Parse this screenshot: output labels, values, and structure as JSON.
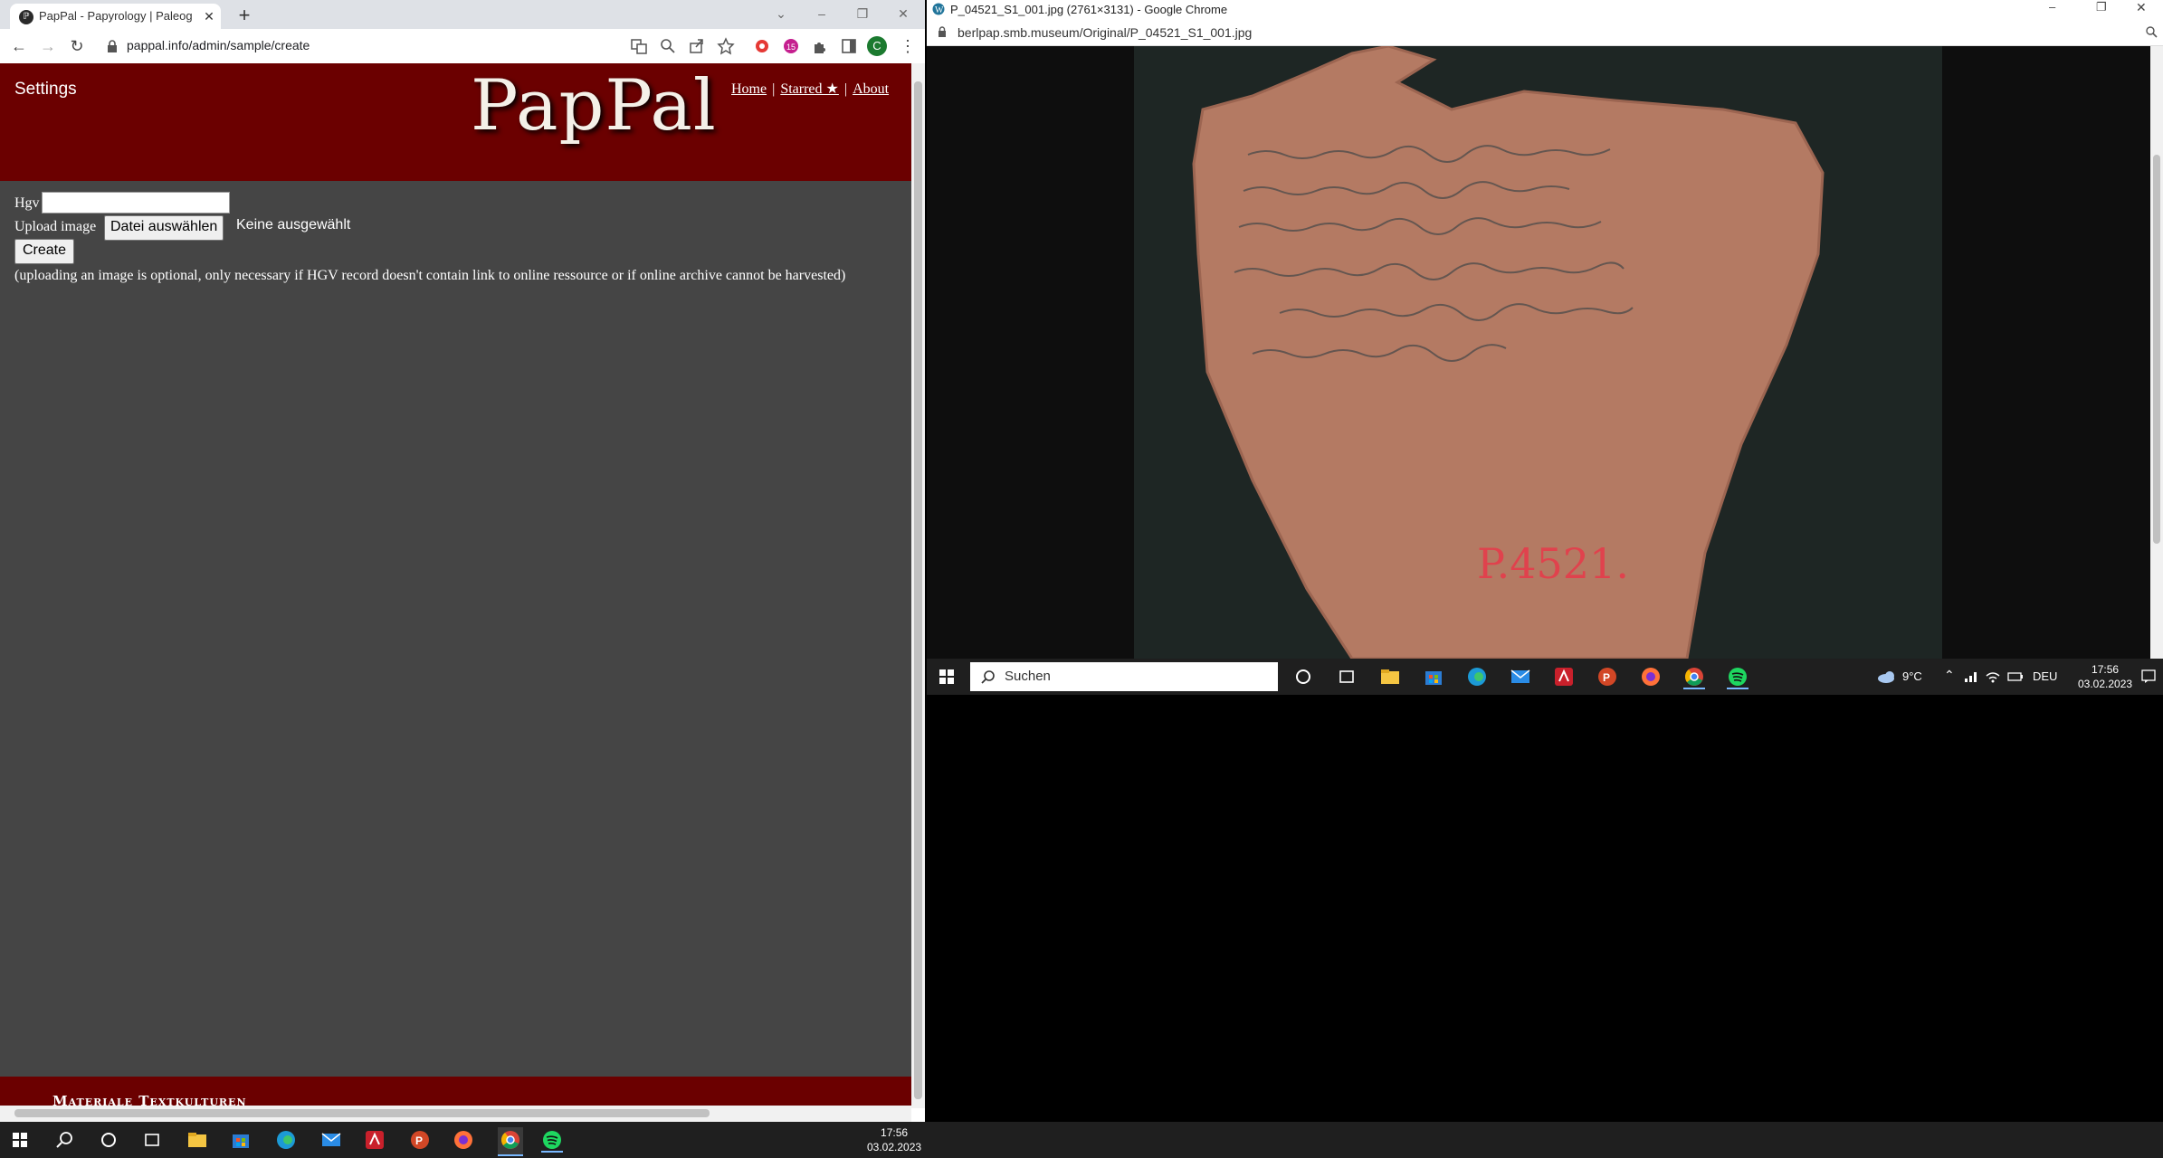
{
  "left_window": {
    "tab_title": "PapPal - Papyrology | Paleography",
    "url": "pappal.info/admin/sample/create",
    "profile_initial": "C"
  },
  "page": {
    "settings_label": "Settings",
    "logo_text": "PapPal",
    "nav": {
      "home": "Home",
      "starred": "Starred ★",
      "about": "About",
      "separator": "|"
    },
    "form": {
      "hgv_label": "Hgv",
      "hgv_value": "",
      "upload_label": "Upload image",
      "file_button": "Datei auswählen",
      "file_status": "Keine ausgewählt",
      "create_button": "Create",
      "note": "(uploading an image is optional, only necessary if HGV record doesn't contain link to online ressource or if online archive cannot be harvested)"
    },
    "footer_text": "Materiale Textkulturen"
  },
  "right_window": {
    "title": "P_04521_S1_001.jpg (2761×3131) - Google Chrome",
    "url": "berlpap.smb.museum/Original/P_04521_S1_001.jpg",
    "image_label": "P.4521."
  },
  "taskbar_right": {
    "search_placeholder": "Suchen",
    "weather": "9°C",
    "language": "DEU",
    "time": "17:56",
    "date": "03.02.2023"
  },
  "taskbar": {
    "time": "17:56",
    "date": "03.02.2023"
  },
  "colors": {
    "header_maroon": "#6b0000",
    "page_bg": "#454545",
    "taskbar": "#1f1f1f"
  }
}
